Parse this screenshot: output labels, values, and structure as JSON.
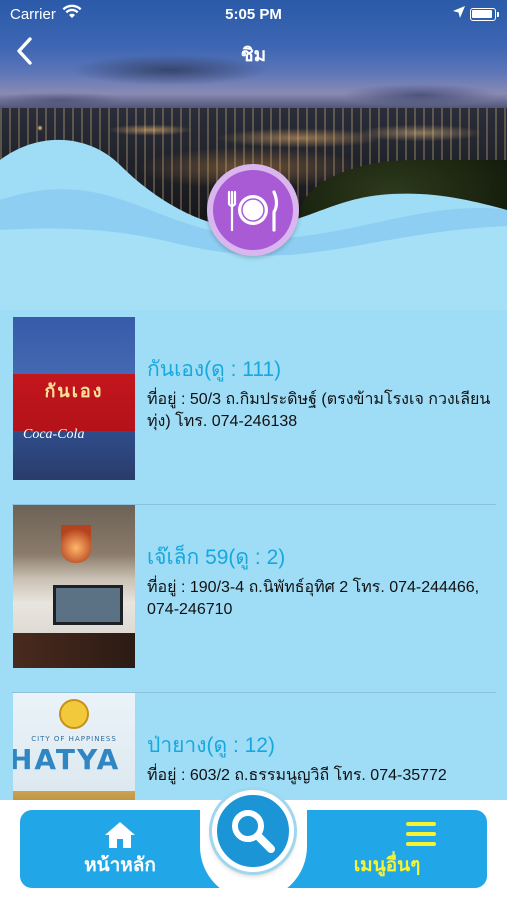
{
  "status_bar": {
    "carrier": "Carrier",
    "time": "5:05 PM",
    "wifi_icon": "wifi-icon",
    "location_icon": "location-arrow-icon",
    "battery_icon": "battery-icon"
  },
  "nav": {
    "title": "ชิม",
    "back_icon": "chevron-left-icon"
  },
  "category_icon": "plate-fork-knife-icon",
  "restaurants": [
    {
      "name": "กันเอง(ดู : 111)",
      "address": "ที่อยู่  :  50/3  ถ.กิมประดิษฐ์ (ตรงข้ามโรงเจ กวงเลียนทุ่ง)  โทร.  074-246138",
      "thumb_text": "กันเอง",
      "thumb_brand": "Coca-Cola"
    },
    {
      "name": "เจ๊เล็ก 59(ดู : 2)",
      "address": "ที่อยู่  :  190/3-4  ถ.นิพัทธ์อุทิศ 2  โทร.  074-244466, 074-246710"
    },
    {
      "name": "ป่ายาง(ดู : 12)",
      "address": "ที่อยู่  :  603/2  ถ.ธรรมนูญวิถี  โทร.  074-35772",
      "thumb_subtitle": "CITY OF HAPPINESS",
      "thumb_text": "HATYA"
    }
  ],
  "tabbar": {
    "home_label": "หน้าหลัก",
    "home_icon": "home-icon",
    "search_icon": "search-icon",
    "more_label": "เมนูอื่นๆ",
    "more_icon": "hamburger-menu-icon"
  },
  "colors": {
    "accent_blue": "#21a6e7",
    "name_blue": "#17a8de",
    "badge_purple": "#a95bd6",
    "more_label_yellow": "#f7f232",
    "background": "#9fdcf6"
  }
}
